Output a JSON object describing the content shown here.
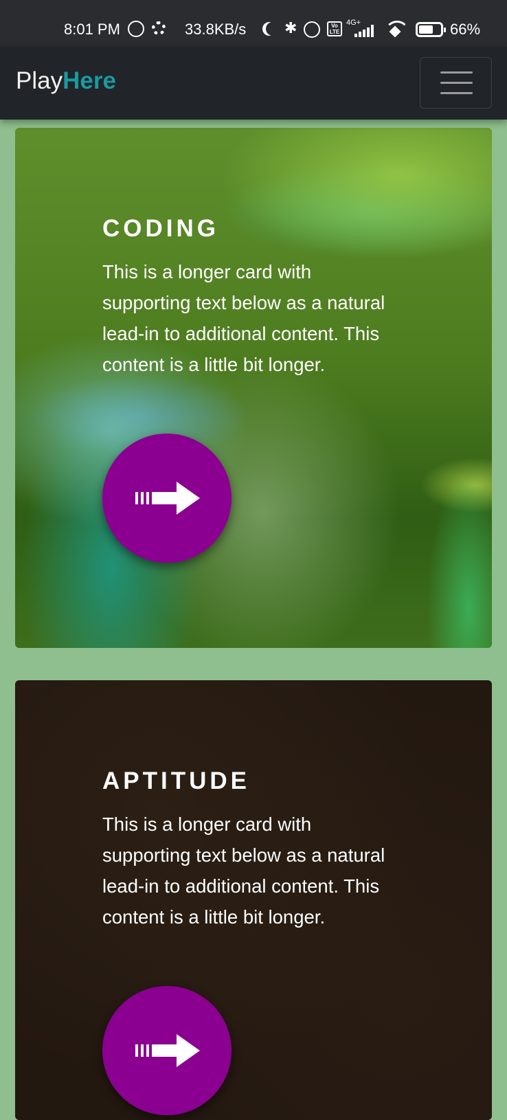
{
  "status_bar": {
    "time": "8:01 PM",
    "net_speed": "33.8KB/s",
    "network_type": "4G+",
    "volte": "Vo LTE",
    "battery_percent": "66%",
    "battery_level": 0.66,
    "icons": [
      "whatsapp-icon",
      "gear-icon",
      "moon-icon",
      "bluetooth-icon",
      "alarm-icon",
      "volte-icon",
      "signal-icon",
      "wifi-icon",
      "battery-icon"
    ]
  },
  "navbar": {
    "brand_part1": "Play",
    "brand_part2": "Here",
    "brand_color": "#1a9aa0",
    "menu_icon": "hamburger-menu-icon"
  },
  "cards": [
    {
      "title": "CODING",
      "text": "This is a longer card with supporting text below as a natural lead-in to additional content. This content is a little bit longer.",
      "button_icon": "arrow-right-icon"
    },
    {
      "title": "APTITUDE",
      "text": "This is a longer card with supporting text below as a natural lead-in to additional content. This content is a little bit longer.",
      "button_icon": "arrow-right-icon"
    }
  ],
  "colors": {
    "page_background": "#8fbf8e",
    "navbar_background": "#212429",
    "button_color": "#8b0091"
  }
}
